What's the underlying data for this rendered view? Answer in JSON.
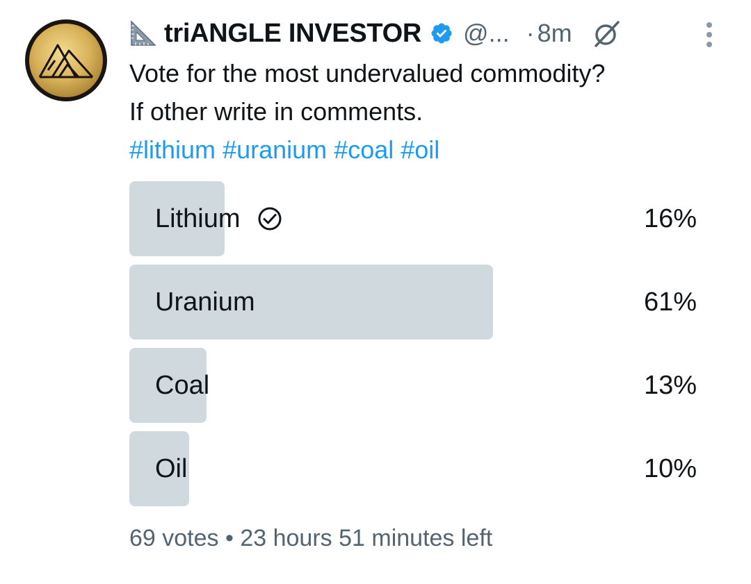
{
  "post": {
    "display_name": "triANGLE INVESTOR",
    "handle": "@...",
    "separator": "·",
    "time": "8m",
    "text_line1": "Vote for the most undervalued commodity?",
    "text_line2": "If other write in comments.",
    "hashtags": [
      "#lithium",
      "#uranium",
      "#coal",
      "#oil"
    ],
    "icons": {
      "avatar": "mountain-logo-avatar",
      "name_prefix": "triangle-ruler-icon",
      "verified": "verified-badge-icon",
      "grok": "grok-icon",
      "more": "more-options-icon",
      "voted": "check-circle-icon"
    },
    "colors": {
      "accent": "#1d9bf0",
      "bar": "#cfd9de",
      "muted": "#536471",
      "text": "#0f1419"
    }
  },
  "poll": {
    "options": [
      {
        "label": "Lithium",
        "percent_label": "16%",
        "percent": 16,
        "voted": true
      },
      {
        "label": "Uranium",
        "percent_label": "61%",
        "percent": 61,
        "voted": false
      },
      {
        "label": "Coal",
        "percent_label": "13%",
        "percent": 13,
        "voted": false
      },
      {
        "label": "Oil",
        "percent_label": "10%",
        "percent": 10,
        "voted": false
      }
    ],
    "votes": "69 votes",
    "dot": "•",
    "time_left": "23 hours 51 minutes left"
  }
}
